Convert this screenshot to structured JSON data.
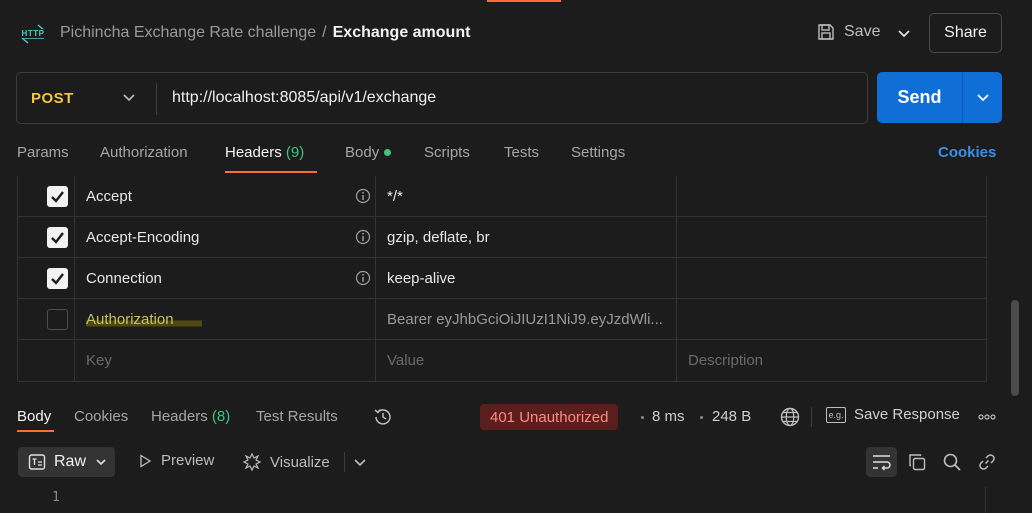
{
  "header": {
    "collection": "Pichincha Exchange Rate challenge",
    "separator": "/",
    "request_name": "Exchange amount",
    "save_label": "Save",
    "share_label": "Share",
    "http_icon_text": "HTTP"
  },
  "request": {
    "method": "POST",
    "url": "http://localhost:8085/api/v1/exchange",
    "send_label": "Send"
  },
  "tabs": {
    "params": "Params",
    "authorization": "Authorization",
    "headers": "Headers",
    "headers_count": "(9)",
    "body": "Body",
    "scripts": "Scripts",
    "tests": "Tests",
    "settings": "Settings",
    "cookies": "Cookies"
  },
  "headers_table": {
    "rows": [
      {
        "key": "Accept",
        "value": "*/*",
        "checked": true
      },
      {
        "key": "Accept-Encoding",
        "value": "gzip, deflate, br",
        "checked": true
      },
      {
        "key": "Connection",
        "value": "keep-alive",
        "checked": true
      },
      {
        "key": "Authorization",
        "value": "Bearer eyJhbGciOiJIUzI1NiJ9.eyJzdWli...",
        "checked": false
      }
    ],
    "placeholder_key": "Key",
    "placeholder_value": "Value",
    "placeholder_description": "Description"
  },
  "response": {
    "tabs": {
      "body": "Body",
      "cookies": "Cookies",
      "headers": "Headers",
      "headers_count": "(8)",
      "test_results": "Test Results"
    },
    "status": "401 Unauthorized",
    "time": "8 ms",
    "size": "248 B",
    "save_response": "Save Response",
    "eg_icon_text": "e.g.",
    "format": "Raw",
    "preview": "Preview",
    "visualize": "Visualize",
    "line_number": "1"
  },
  "colors": {
    "accent": "#ff6c37",
    "send": "#0f6fd6",
    "method": "#f4c542",
    "success": "#3ec47f",
    "error_bg": "#5a1f1c",
    "error_text": "#ff8a80",
    "link": "#3d8fe6"
  }
}
